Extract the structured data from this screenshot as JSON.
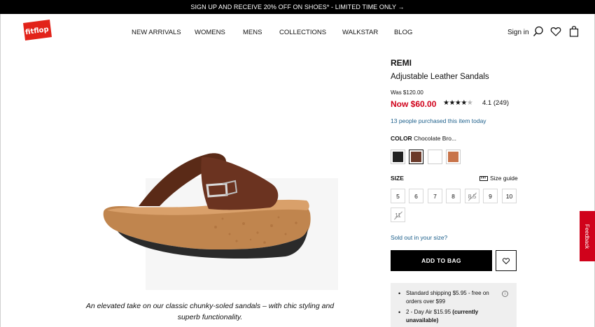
{
  "promo": {
    "text": "SIGN UP AND RECEIVE 20% OFF ON SHOES* - LIMITED TIME ONLY →"
  },
  "header": {
    "logo_text": "fitflop",
    "nav": [
      "NEW ARRIVALS",
      "WOMENS",
      "MENS",
      "COLLECTIONS",
      "WALKSTAR",
      "BLOG"
    ],
    "sign_in": "Sign in",
    "icons": [
      "search-icon",
      "heart-icon",
      "bag-icon"
    ]
  },
  "product": {
    "name": "REMI",
    "subtitle": "Adjustable Leather Sandals",
    "was_price": "Was $120.00",
    "now_price": "Now $60.00",
    "rating_value": 4.1,
    "rating_text": "4.1 (249)",
    "purchased": "13 people purchased this item today",
    "color_label": "COLOR",
    "color_value": "Chocolate Bro...",
    "swatches": [
      {
        "name": "Black",
        "color": "#222222"
      },
      {
        "name": "Chocolate Brown",
        "color": "#6b3a2a",
        "selected": true
      },
      {
        "name": "White",
        "color": "#ffffff"
      },
      {
        "name": "Tan",
        "color": "#c8744a"
      }
    ],
    "size_label": "SIZE",
    "size_guide": "Size guide",
    "sizes": [
      {
        "label": "5",
        "available": true
      },
      {
        "label": "6",
        "available": true
      },
      {
        "label": "7",
        "available": true
      },
      {
        "label": "8",
        "available": true
      },
      {
        "label": "8.5",
        "available": false
      },
      {
        "label": "9",
        "available": true
      },
      {
        "label": "10",
        "available": true
      },
      {
        "label": "11",
        "available": false
      }
    ],
    "sold_out": "Sold out in your size?",
    "add_to_bag": "ADD TO BAG",
    "description": "An elevated take on our classic chunky-soled sandals – with chic styling and superb functionality."
  },
  "shipping": {
    "items": [
      "Standard shipping $5.95 - free on orders over $99",
      "2 - Day Air $15.95"
    ],
    "unavailable": "(currently unavailable)"
  },
  "feedback": "Feedback",
  "colors": {
    "accent_red": "#d0021b",
    "link_blue": "#1b5e8a"
  }
}
